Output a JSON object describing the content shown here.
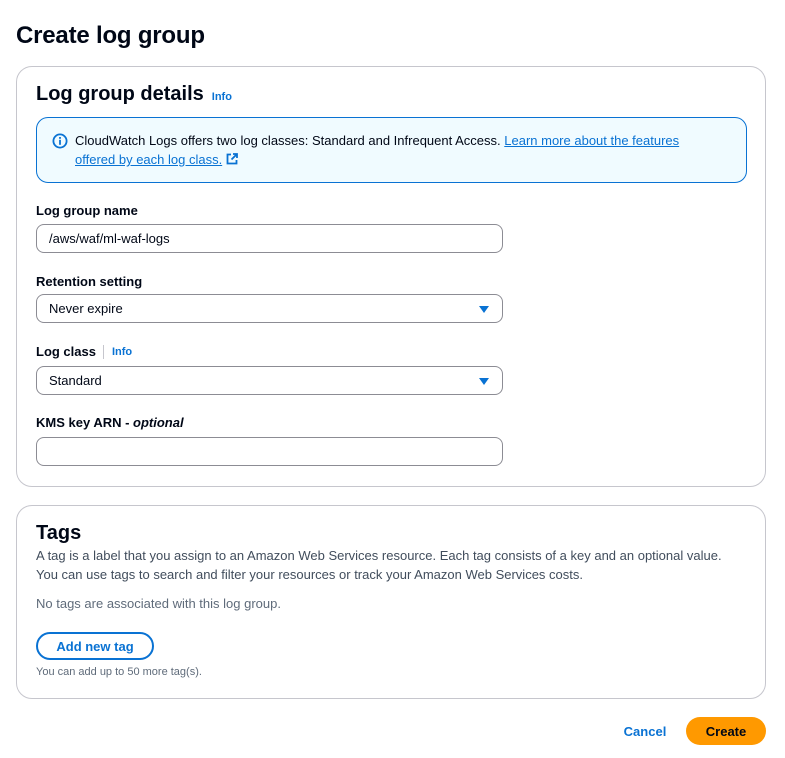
{
  "page": {
    "title": "Create log group"
  },
  "details": {
    "title": "Log group details",
    "info": "Info",
    "alert": {
      "text": "CloudWatch Logs offers two log classes: Standard and Infrequent Access.",
      "link": "Learn more about the features offered by each log class.",
      "icon": "info-circle-icon",
      "link_icon": "external-link-icon"
    },
    "name_field": {
      "label": "Log group name",
      "value": "/aws/waf/ml-waf-logs"
    },
    "retention_field": {
      "label": "Retention setting",
      "value": "Never expire"
    },
    "log_class_field": {
      "label": "Log class",
      "info": "Info",
      "value": "Standard"
    },
    "kms_field": {
      "label": "KMS key ARN - ",
      "optional": "optional",
      "value": ""
    }
  },
  "tags": {
    "title": "Tags",
    "description": "A tag is a label that you assign to an Amazon Web Services resource. Each tag consists of a key and an optional value. You can use tags to search and filter your resources or track your Amazon Web Services costs.",
    "empty": "No tags are associated with this log group.",
    "add_button": "Add new tag",
    "hint": "You can add up to 50 more tag(s)."
  },
  "footer": {
    "cancel": "Cancel",
    "create": "Create"
  },
  "colors": {
    "accent": "#0972d3",
    "primary_button": "#ff9900",
    "alert_bg": "#f0fbff"
  }
}
